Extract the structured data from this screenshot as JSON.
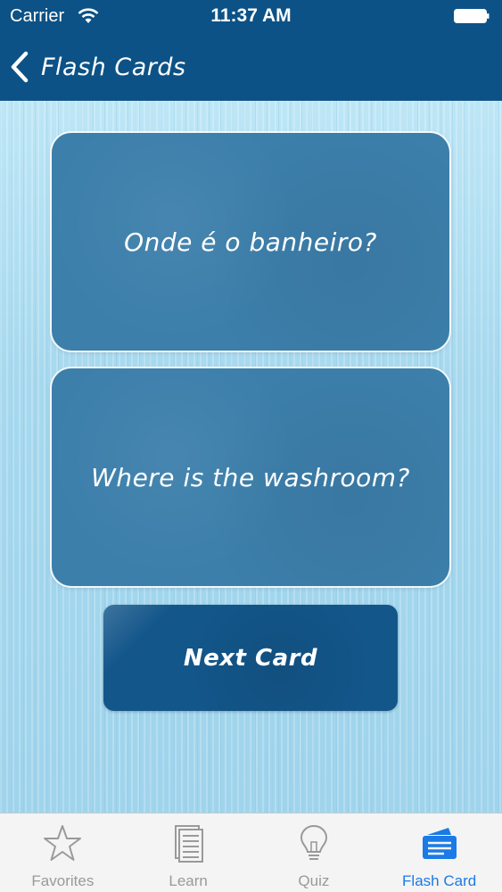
{
  "status": {
    "carrier": "Carrier",
    "time": "11:37 AM"
  },
  "nav": {
    "back_label": "Flash Cards"
  },
  "card": {
    "question": "Onde é o banheiro?",
    "answer": "Where is the washroom?"
  },
  "actions": {
    "next_label": "Next Card"
  },
  "tabs": [
    {
      "label": "Favorites",
      "icon": "star-icon",
      "active": false
    },
    {
      "label": "Learn",
      "icon": "document-icon",
      "active": false
    },
    {
      "label": "Quiz",
      "icon": "lightbulb-icon",
      "active": false
    },
    {
      "label": "Flash Card",
      "icon": "flash-card-icon",
      "active": true
    }
  ],
  "colors": {
    "nav_bar": "#0c5286",
    "card": "#3c7fab",
    "button": "#13568a",
    "tab_active": "#1b7ae6",
    "tab_inactive": "#9a9a9a"
  }
}
